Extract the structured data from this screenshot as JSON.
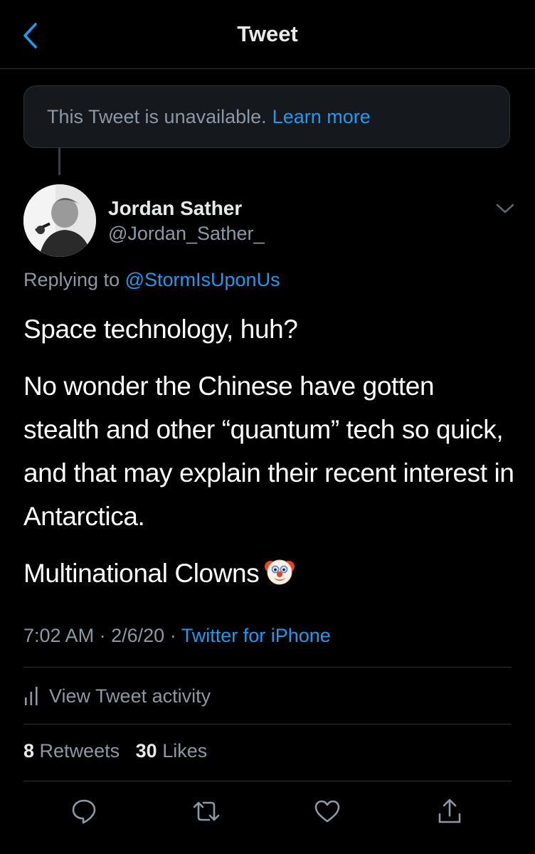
{
  "navbar": {
    "title": "Tweet"
  },
  "unavailable": {
    "text": "This Tweet is unavailable.",
    "link": "Learn more"
  },
  "author": {
    "name": "Jordan Sather",
    "handle": "@Jordan_Sather_"
  },
  "reply": {
    "prefix": "Replying to",
    "mention": "@StormIsUponUs"
  },
  "tweet": {
    "paragraphs": [
      "Space technology, huh?",
      "No wonder the Chinese have gotten stealth and other “quantum” tech so quick, and that may explain their recent interest in Antarctica.",
      "Multinational Clowns"
    ]
  },
  "meta": {
    "time": "7:02 AM",
    "date": "2/6/20",
    "source": "Twitter for iPhone",
    "separator": "·"
  },
  "activity": {
    "label": "View Tweet activity"
  },
  "stats": {
    "retweets": "8",
    "retweets_label": "Retweets",
    "likes": "30",
    "likes_label": "Likes"
  },
  "colors": {
    "background": "#000000",
    "accent": "#1d9bf0",
    "secondary_text": "#8b98a5",
    "border": "#2f3336"
  },
  "icons": [
    "back-chevron-icon",
    "chevron-down-icon",
    "clown-emoji-icon",
    "bar-chart-icon",
    "reply-icon",
    "retweet-icon",
    "like-icon",
    "share-icon"
  ]
}
